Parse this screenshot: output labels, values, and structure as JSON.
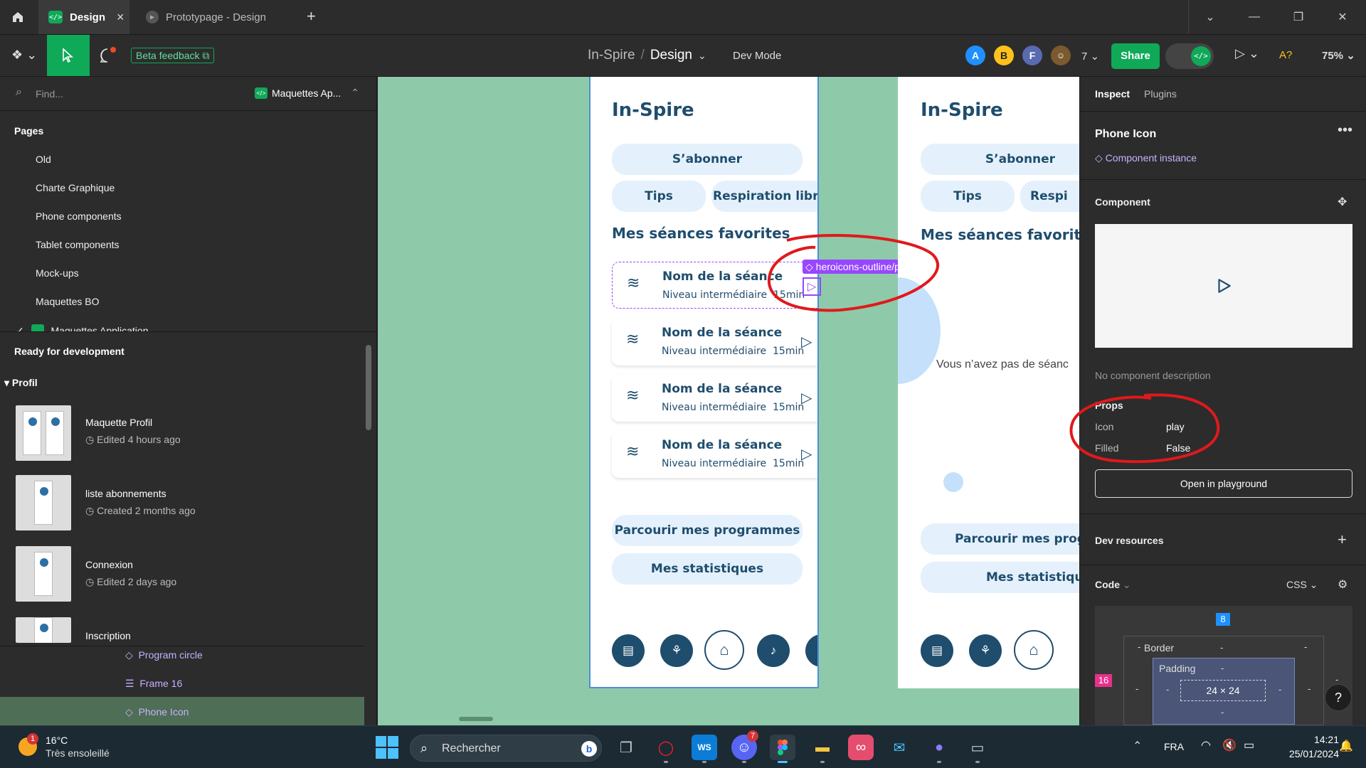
{
  "tabs": {
    "home_icon": "home-icon",
    "items": [
      {
        "label": "Design",
        "close": "×"
      },
      {
        "label": "Prototypage - Design"
      }
    ],
    "new_tab": "+"
  },
  "toolbar": {
    "beta_feedback": "Beta feedback",
    "breadcrumb_project": "In-Spire",
    "breadcrumb_sep": "/",
    "breadcrumb_file": "Design",
    "dev_mode": "Dev Mode",
    "avatars": [
      "A",
      "B",
      "F"
    ],
    "user_count": "7",
    "share": "Share",
    "zoom": "75%",
    "font_icon": "A?"
  },
  "left_panel": {
    "search_placeholder": "Find...",
    "file_name": "Maquettes Ap...",
    "pages_header": "Pages",
    "pages": [
      "Old",
      "Charte Graphique",
      "Phone components",
      "Tablet components",
      "Mock-ups",
      "Maquettes BO",
      "Maquettes Application"
    ],
    "ready_header": "Ready for development",
    "section": "Profil",
    "frames": [
      {
        "title": "Maquette Profil",
        "meta": "Edited 4 hours ago"
      },
      {
        "title": "liste abonnements",
        "meta": "Created 2 months ago"
      },
      {
        "title": "Connexion",
        "meta": "Edited 2 days ago"
      },
      {
        "title": "Inscription",
        "meta": ""
      }
    ],
    "layers": [
      "Program circle",
      "Frame 16",
      "Phone Icon"
    ]
  },
  "phone": {
    "app_title": "In-Spire",
    "subscribe": "S’abonner",
    "tips": "Tips",
    "breathing": "Respiration libre",
    "favorites": "Mes séances favorites",
    "session_name": "Nom de la séance",
    "session_level": "Niveau intermédiaire",
    "session_duration": "15min",
    "programs": "Parcourir mes programmes",
    "stats": "Mes statistiques",
    "component_tag": "heroicons-outline/play",
    "empty": "Vous n’avez pas de séanc",
    "breathing_cut": "Respi",
    "favorites2": "Mes séances favorites",
    "programs2": "Parcourir mes progra",
    "stats2": "Mes statistique"
  },
  "right_panel": {
    "tab_inspect": "Inspect",
    "tab_plugins": "Plugins",
    "layer_name": "Phone Icon",
    "instance": "Component instance",
    "component_header": "Component",
    "no_description": "No component description",
    "props_header": "Props",
    "props": [
      {
        "key": "Icon",
        "value": "play"
      },
      {
        "key": "Filled",
        "value": "False"
      }
    ],
    "playground": "Open in playground",
    "dev_resources": "Dev resources",
    "code": "Code",
    "code_lang": "CSS",
    "box": {
      "margin_top": "8",
      "margin_left": "16",
      "border": "Border",
      "padding": "Padding",
      "size": "24 × 24",
      "dash": "-"
    }
  },
  "taskbar": {
    "weather_temp": "16°C",
    "weather_desc": "Très ensoleillé",
    "weather_badge": "1",
    "search": "Rechercher",
    "lang": "FRA",
    "time": "14:21",
    "date": "25/01/2024",
    "discord_badge": "7"
  },
  "colors": {
    "canvas": "#8ecaa9",
    "brand": "#1f4d6d",
    "accent_green": "#0fa958",
    "purple": "#9747ff",
    "annotation": "#e0191b"
  }
}
